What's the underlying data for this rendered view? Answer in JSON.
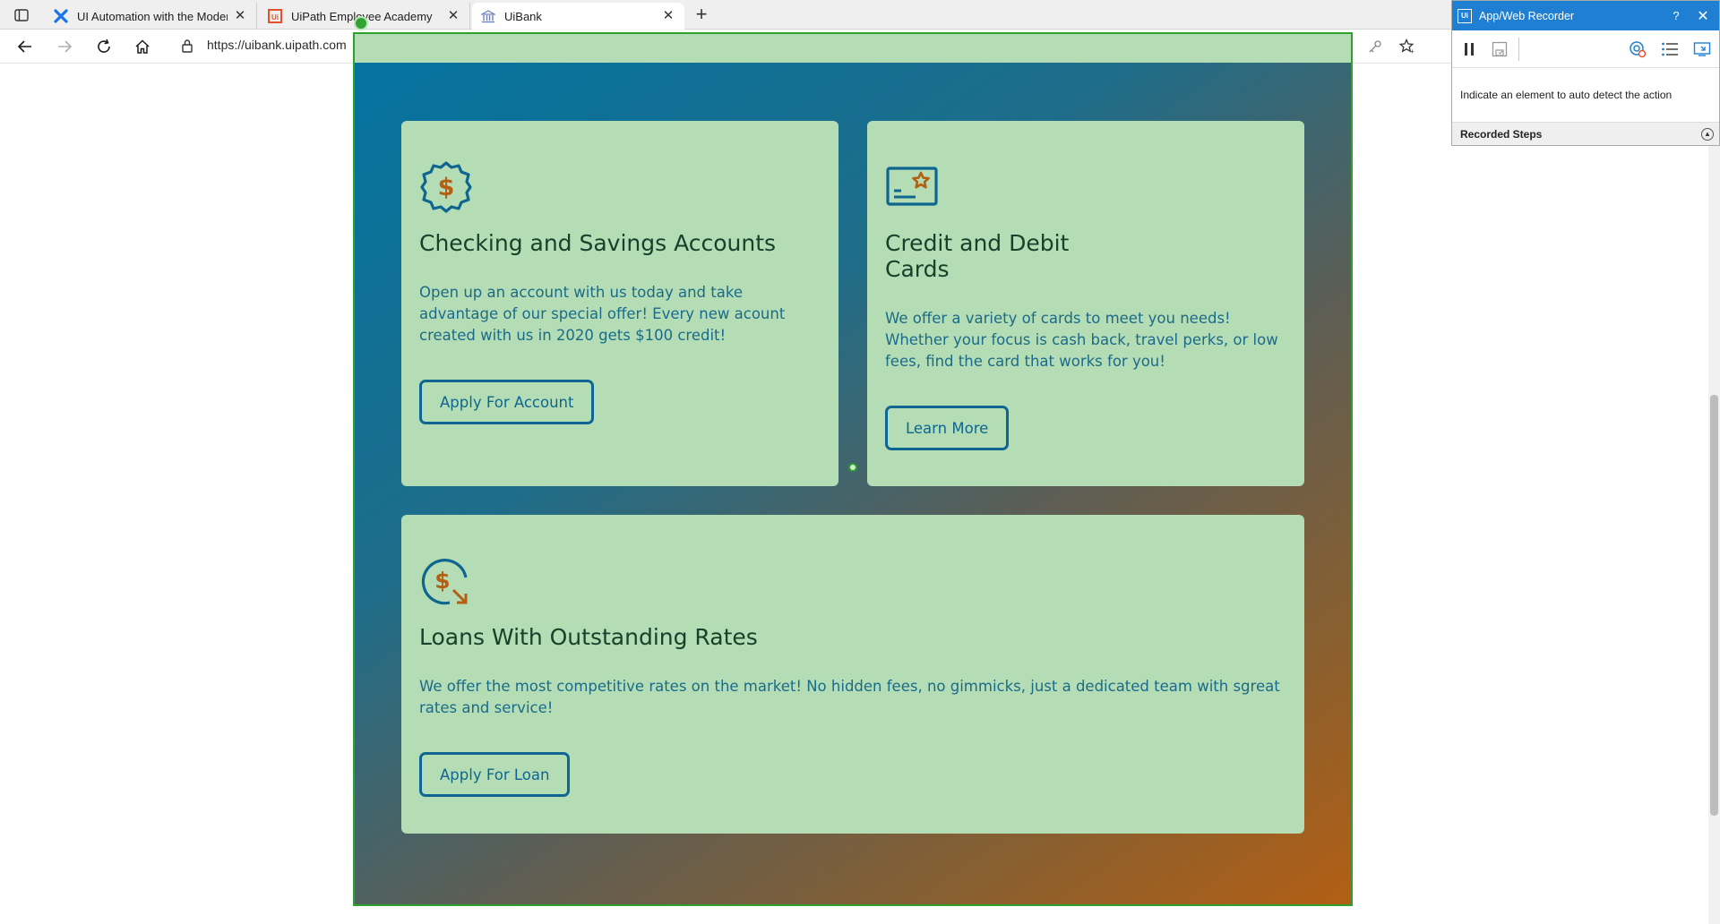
{
  "browser": {
    "tabs": [
      {
        "title": "UI Automation with the Modern",
        "icon": "uipath-academy-icon"
      },
      {
        "title": "UiPath Employee Academy",
        "icon": "uipath-logo-icon"
      },
      {
        "title": "UiBank",
        "icon": "bank-icon"
      }
    ],
    "active_tab": 2,
    "url": "https://uibank.uipath.com"
  },
  "cards": [
    {
      "title": "Checking and Savings Accounts",
      "body": "Open up an account with us today and take advantage of our special offer! Every new acount created with us in 2020 gets $100 credit!",
      "button": "Apply For Account",
      "icon": "dollar-badge-icon"
    },
    {
      "title": "Credit and Debit Cards",
      "body": "We offer a variety of cards to meet you needs! Whether your focus is cash back, travel perks, or low fees, find the card that works for you!",
      "button": "Learn More",
      "icon": "credit-card-star-icon"
    },
    {
      "title": "Loans With Outstanding Rates",
      "body": "We offer the most competitive rates on the market! No hidden fees, no gimmicks, just a dedicated team with sgreat rates and service!",
      "button": "Apply For Loan",
      "icon": "dollar-down-rate-icon"
    }
  ],
  "recorder": {
    "title": "App/Web Recorder",
    "help": "?",
    "hint": "Indicate an element to auto detect the action",
    "steps_label": "Recorded Steps"
  },
  "colors": {
    "card_bg": "#b5ddb5",
    "accent_blue": "#0e6690",
    "accent_orange": "#b35f14",
    "highlight_green": "#2ea02e",
    "recorder_blue": "#1f7fd2"
  }
}
